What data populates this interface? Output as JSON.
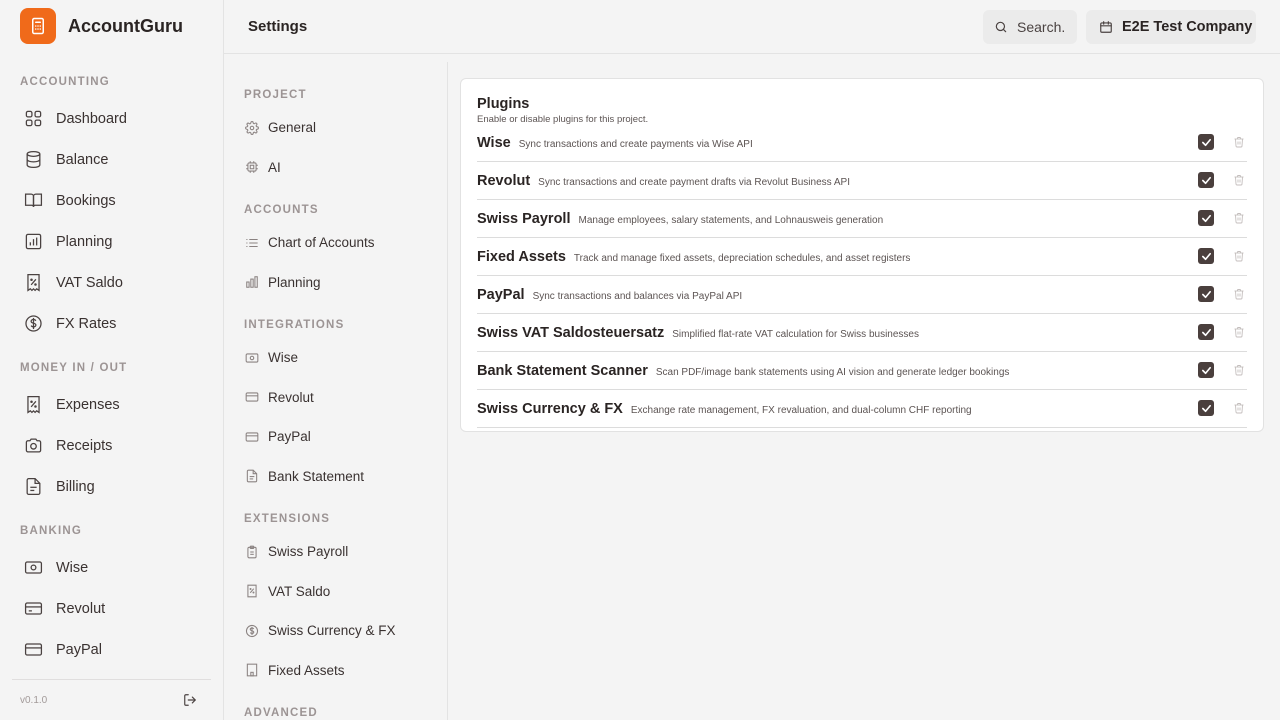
{
  "app": {
    "name": "AccountGuru",
    "version": "v0.1.0"
  },
  "header": {
    "title": "Settings",
    "search_placeholder": "Search.",
    "company": "E2E Test Company"
  },
  "sidebar": {
    "sections": [
      {
        "label": "ACCOUNTING",
        "items": [
          {
            "label": "Dashboard",
            "icon": "grid-icon"
          },
          {
            "label": "Balance",
            "icon": "database-icon"
          },
          {
            "label": "Bookings",
            "icon": "book-icon"
          },
          {
            "label": "Planning",
            "icon": "bar-chart-icon"
          },
          {
            "label": "VAT Saldo",
            "icon": "percent-file-icon"
          },
          {
            "label": "FX Rates",
            "icon": "dollar-circle-icon"
          }
        ]
      },
      {
        "label": "MONEY IN / OUT",
        "items": [
          {
            "label": "Expenses",
            "icon": "receipt-percent-icon"
          },
          {
            "label": "Receipts",
            "icon": "camera-icon"
          },
          {
            "label": "Billing",
            "icon": "invoice-icon"
          }
        ]
      },
      {
        "label": "BANKING",
        "items": [
          {
            "label": "Wise",
            "icon": "banknote-icon"
          },
          {
            "label": "Revolut",
            "icon": "credit-card-icon"
          },
          {
            "label": "PayPal",
            "icon": "credit-card-icon"
          }
        ]
      }
    ]
  },
  "settings_nav": {
    "sections": [
      {
        "label": "PROJECT",
        "items": [
          {
            "label": "General",
            "icon": "gear-icon"
          },
          {
            "label": "AI",
            "icon": "chip-icon"
          }
        ]
      },
      {
        "label": "ACCOUNTS",
        "items": [
          {
            "label": "Chart of Accounts",
            "icon": "list-icon"
          },
          {
            "label": "Planning",
            "icon": "bar-chart-icon"
          }
        ]
      },
      {
        "label": "INTEGRATIONS",
        "items": [
          {
            "label": "Wise",
            "icon": "banknote-icon"
          },
          {
            "label": "Revolut",
            "icon": "credit-card-icon"
          },
          {
            "label": "PayPal",
            "icon": "credit-card-icon"
          },
          {
            "label": "Bank Statement",
            "icon": "file-icon"
          }
        ]
      },
      {
        "label": "EXTENSIONS",
        "items": [
          {
            "label": "Swiss Payroll",
            "icon": "clipboard-icon"
          },
          {
            "label": "VAT Saldo",
            "icon": "percent-file-icon"
          },
          {
            "label": "Swiss Currency & FX",
            "icon": "dollar-circle-icon"
          },
          {
            "label": "Fixed Assets",
            "icon": "building-icon"
          }
        ]
      },
      {
        "label": "ADVANCED",
        "items": []
      }
    ]
  },
  "plugins": {
    "title": "Plugins",
    "subtitle": "Enable or disable plugins for this project.",
    "items": [
      {
        "name": "Wise",
        "description": "Sync transactions and create payments via Wise API",
        "enabled": true
      },
      {
        "name": "Revolut",
        "description": "Sync transactions and create payment drafts via Revolut Business API",
        "enabled": true
      },
      {
        "name": "Swiss Payroll",
        "description": "Manage employees, salary statements, and Lohnausweis generation",
        "enabled": true
      },
      {
        "name": "Fixed Assets",
        "description": "Track and manage fixed assets, depreciation schedules, and asset registers",
        "enabled": true
      },
      {
        "name": "PayPal",
        "description": "Sync transactions and balances via PayPal API",
        "enabled": true
      },
      {
        "name": "Swiss VAT Saldosteuersatz",
        "description": "Simplified flat-rate VAT calculation for Swiss businesses",
        "enabled": true
      },
      {
        "name": "Bank Statement Scanner",
        "description": "Scan PDF/image bank statements using AI vision and generate ledger bookings",
        "enabled": true
      },
      {
        "name": "Swiss Currency & FX",
        "description": "Exchange rate management, FX revaluation, and dual-column CHF reporting",
        "enabled": true
      }
    ]
  },
  "colors": {
    "accent": "#f06a1a",
    "checkbox": "#4a3f3d",
    "background": "#f4f4f4",
    "card": "#ffffff"
  }
}
